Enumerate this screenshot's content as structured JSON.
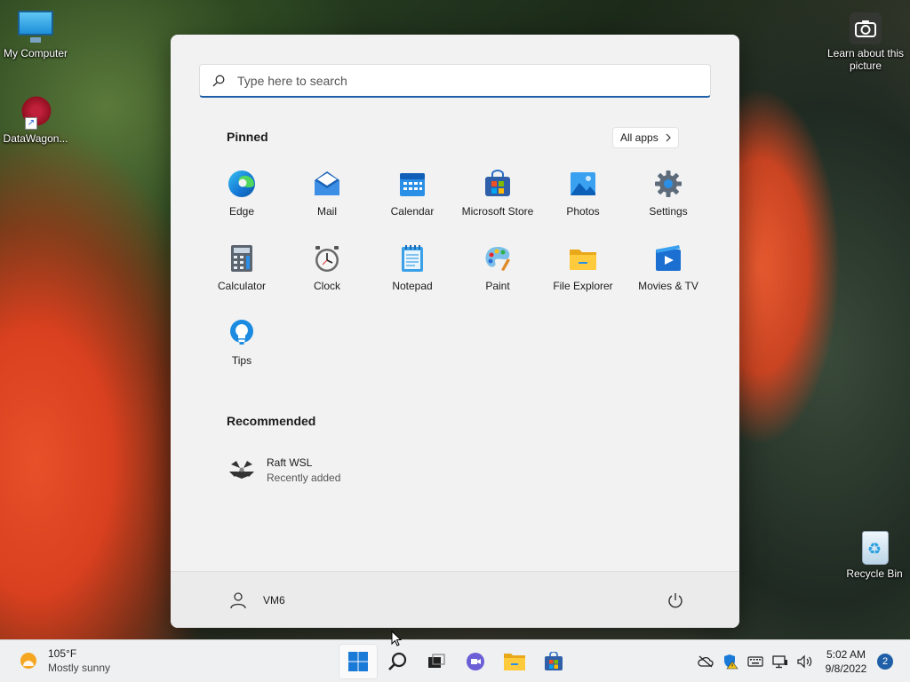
{
  "desktop": {
    "icons": [
      {
        "label": "My Computer"
      },
      {
        "label": "DataWagon..."
      },
      {
        "label": "Learn about this picture"
      },
      {
        "label": "Recycle Bin"
      }
    ]
  },
  "start_menu": {
    "search": {
      "placeholder": "Type here to search"
    },
    "pinned_title": "Pinned",
    "all_apps_label": "All apps",
    "pinned": [
      {
        "label": "Edge",
        "icon": "edge-icon"
      },
      {
        "label": "Mail",
        "icon": "mail-icon"
      },
      {
        "label": "Calendar",
        "icon": "calendar-icon"
      },
      {
        "label": "Microsoft Store",
        "icon": "store-icon"
      },
      {
        "label": "Photos",
        "icon": "photos-icon"
      },
      {
        "label": "Settings",
        "icon": "gear-icon"
      },
      {
        "label": "Calculator",
        "icon": "calculator-icon"
      },
      {
        "label": "Clock",
        "icon": "clock-icon"
      },
      {
        "label": "Notepad",
        "icon": "notepad-icon"
      },
      {
        "label": "Paint",
        "icon": "paint-icon"
      },
      {
        "label": "File Explorer",
        "icon": "folder-icon"
      },
      {
        "label": "Movies & TV",
        "icon": "movies-icon"
      },
      {
        "label": "Tips",
        "icon": "lightbulb-icon"
      }
    ],
    "recommended_title": "Recommended",
    "recommended": [
      {
        "name": "Raft WSL",
        "subtitle": "Recently added"
      }
    ],
    "user": {
      "name": "VM6"
    }
  },
  "taskbar": {
    "weather": {
      "temp": "105°F",
      "condition": "Mostly sunny"
    },
    "clock": {
      "time": "5:02 AM",
      "date": "9/8/2022"
    },
    "notification_count": "2"
  },
  "colors": {
    "accent": "#1f5fa8",
    "menu_bg": "#f2f2f2",
    "taskbar_bg": "#eef0f2"
  }
}
